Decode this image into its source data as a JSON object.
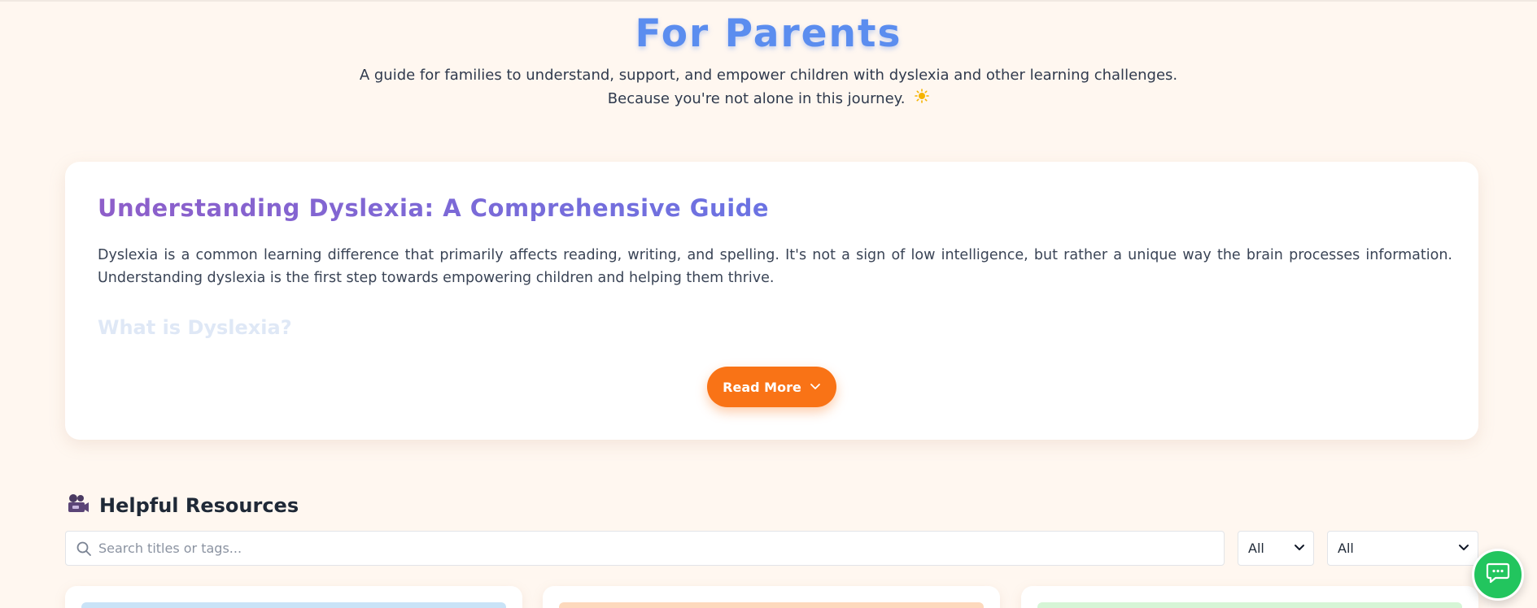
{
  "hero": {
    "title": "For Parents",
    "subtitle_line1": "A guide for families to understand, support, and empower children with dyslexia and other learning challenges.",
    "subtitle_line2": "Because you're not alone in this journey."
  },
  "article": {
    "title": "Understanding Dyslexia: A Comprehensive Guide",
    "body": "Dyslexia is a common learning difference that primarily affects reading, writing, and spelling. It's not a sign of low intelligence, but rather a unique way the brain processes information. Understanding dyslexia is the first step towards empowering children and helping them thrive.",
    "faded_heading": "What is Dyslexia?",
    "read_more_label": "Read More"
  },
  "resources": {
    "title": "Helpful Resources",
    "search_placeholder": "Search titles or tags...",
    "filter1_value": "All",
    "filter2_value": "All"
  },
  "icons": {
    "sun": "sun-icon",
    "camera": "video-camera-icon",
    "search": "search-icon",
    "chevron": "chevron-down-icon",
    "chat": "chat-icon"
  },
  "colors": {
    "accent_orange": "#f97316",
    "title_blue": "#5b8def",
    "chat_green": "#22c55e",
    "background": "#fff7f0"
  }
}
